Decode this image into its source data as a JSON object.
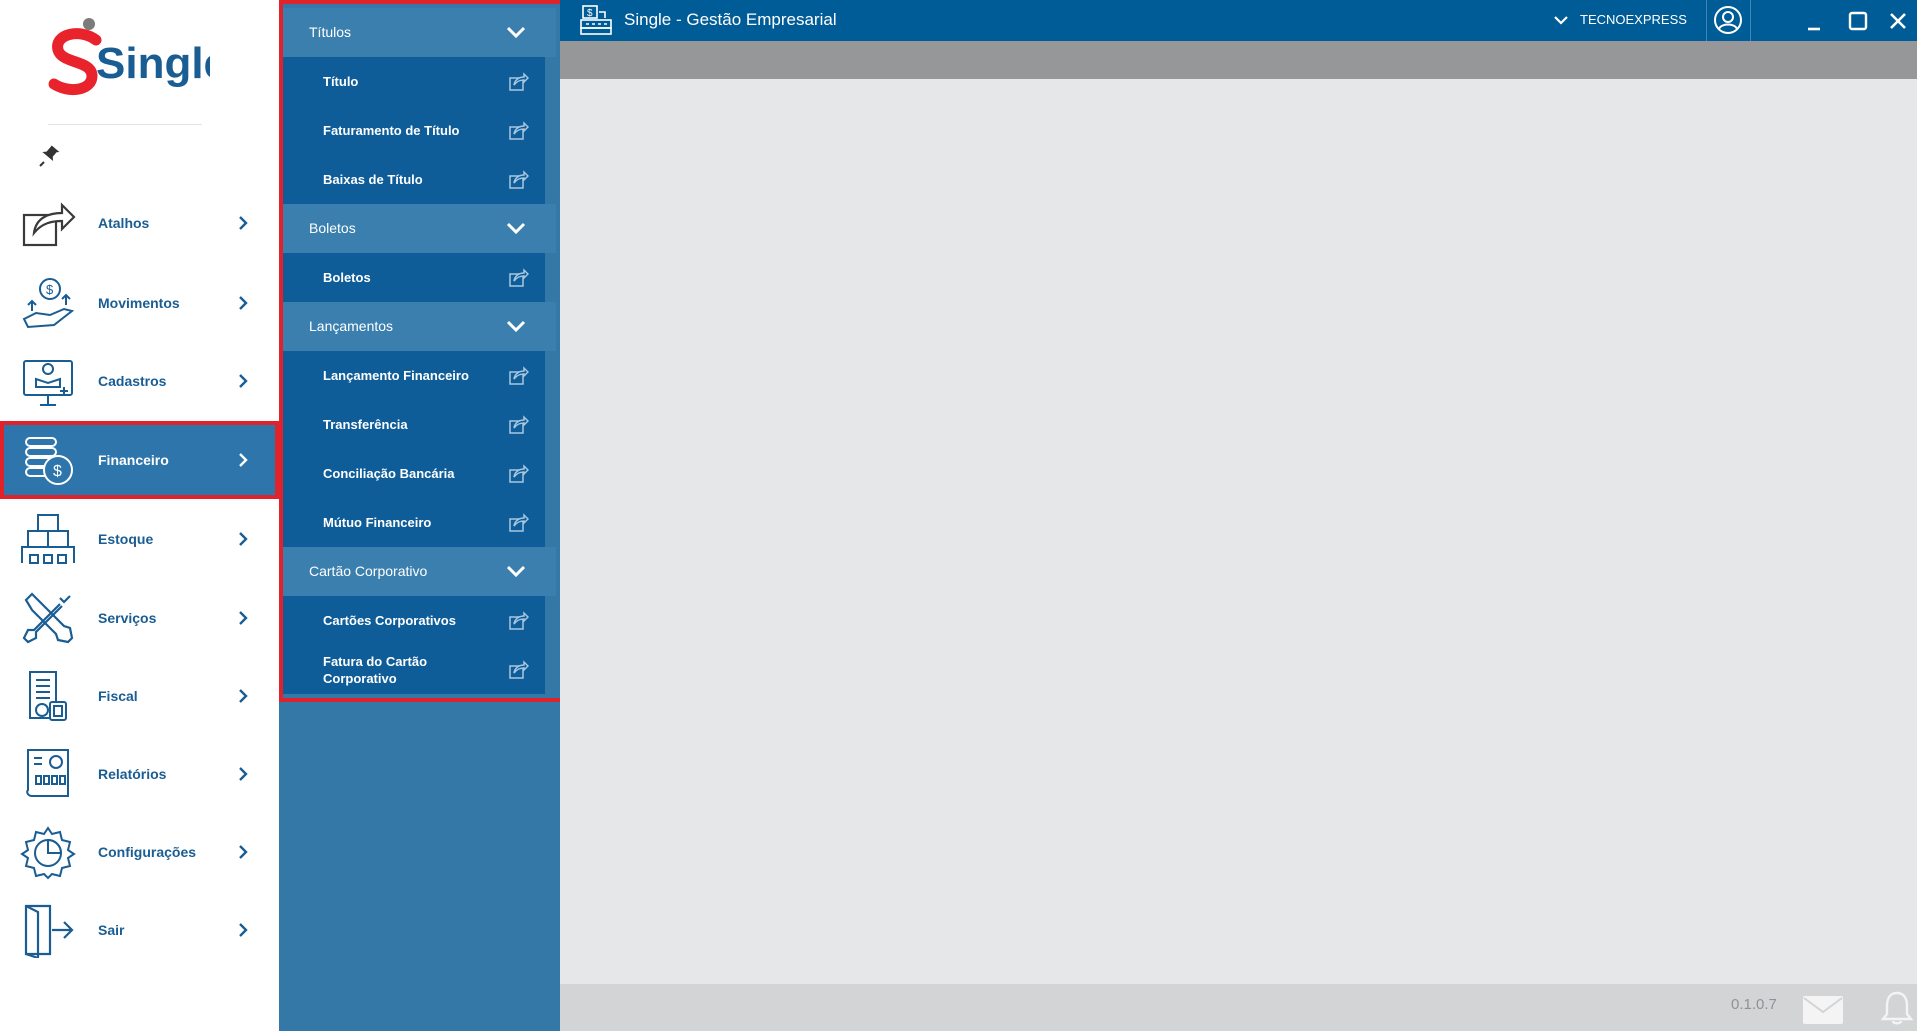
{
  "app": {
    "title": "Single - Gestão Empresarial",
    "company": "TECNOEXPRESS",
    "version": "0.1.0.7"
  },
  "logo": {
    "text": "Single"
  },
  "colors": {
    "brand_blue": "#005c96",
    "menu_blue": "#3478a7",
    "item_blue": "#0e5d99",
    "highlight_red": "#e0222a",
    "logo_red": "#e8232b"
  },
  "sidebar": {
    "items": [
      {
        "label": "Atalhos",
        "icon": "share-icon"
      },
      {
        "label": "Movimentos",
        "icon": "money-hand-icon"
      },
      {
        "label": "Cadastros",
        "icon": "monitor-user-icon"
      },
      {
        "label": "Financeiro",
        "icon": "coins-icon",
        "active": true
      },
      {
        "label": "Estoque",
        "icon": "warehouse-icon"
      },
      {
        "label": "Serviços",
        "icon": "tools-icon"
      },
      {
        "label": "Fiscal",
        "icon": "fiscal-doc-icon"
      },
      {
        "label": "Relatórios",
        "icon": "report-icon"
      },
      {
        "label": "Configurações",
        "icon": "settings-gear-icon"
      },
      {
        "label": "Sair",
        "icon": "exit-door-icon"
      }
    ]
  },
  "submenu": {
    "sections": [
      {
        "title": "Títulos",
        "items": [
          "Título",
          "Faturamento de Título",
          "Baixas de Título"
        ]
      },
      {
        "title": "Boletos",
        "items": [
          "Boletos"
        ]
      },
      {
        "title": "Lançamentos",
        "items": [
          "Lançamento Financeiro",
          "Transferência",
          "Conciliação Bancária",
          "Mútuo Financeiro"
        ]
      },
      {
        "title": "Cartão Corporativo",
        "items": [
          "Cartões Corporativos",
          "Fatura do Cartão Corporativo"
        ]
      }
    ]
  }
}
